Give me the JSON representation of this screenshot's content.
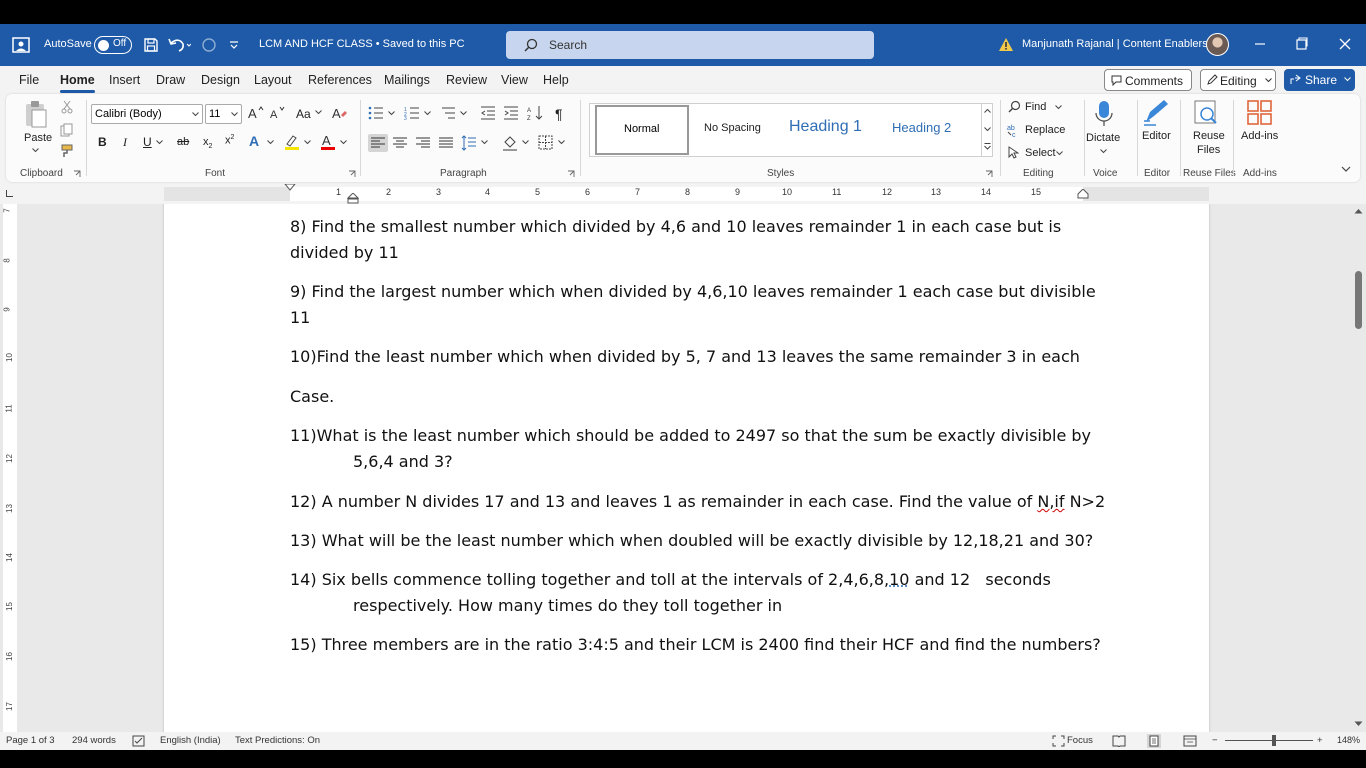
{
  "titlebar": {
    "autosave_label": "AutoSave",
    "autosave_state": "Off",
    "document_title": "LCM AND HCF CLASS • Saved to this PC",
    "search_placeholder": "Search",
    "user_name": "Manjunath Rajanal | Content Enablers"
  },
  "menu": {
    "tabs": [
      "File",
      "Home",
      "Insert",
      "Draw",
      "Design",
      "Layout",
      "References",
      "Mailings",
      "Review",
      "View",
      "Help"
    ],
    "active_tab": "Home",
    "comments_label": "Comments",
    "editing_label": "Editing",
    "share_label": "Share"
  },
  "ribbon": {
    "clipboard": {
      "paste_label": "Paste",
      "group_label": "Clipboard"
    },
    "font": {
      "font_name": "Calibri (Body)",
      "font_size": "11",
      "group_label": "Font",
      "change_case_label": "Aa"
    },
    "paragraph": {
      "group_label": "Paragraph"
    },
    "styles": {
      "items": [
        "Normal",
        "No Spacing",
        "Heading 1",
        "Heading 2"
      ],
      "group_label": "Styles"
    },
    "editing": {
      "find_label": "Find",
      "replace_label": "Replace",
      "select_label": "Select",
      "group_label": "Editing"
    },
    "voice": {
      "dictate_label": "Dictate",
      "group_label": "Voice"
    },
    "editor": {
      "editor_label": "Editor",
      "group_label": "Editor"
    },
    "reuse": {
      "label_line1": "Reuse",
      "label_line2": "Files",
      "group_label": "Reuse Files"
    },
    "addins": {
      "label": "Add-ins",
      "group_label": "Add-ins"
    }
  },
  "ruler": {
    "numbers": [
      "1",
      "2",
      "3",
      "4",
      "5",
      "6",
      "7",
      "8",
      "9",
      "10",
      "11",
      "12",
      "13",
      "14",
      "15"
    ],
    "vertical_numbers": [
      "7",
      "8",
      "9",
      "10",
      "11",
      "12",
      "13",
      "14",
      "15",
      "16",
      "17"
    ]
  },
  "document": {
    "q8_line1": "8) Find the smallest number which divided by 4,6 and 10 leaves remainder 1 in each case but is",
    "q8_line2": "divided by 11",
    "q9_line1": "9) Find the largest number which when divided by 4,6,10 leaves remainder 1 each case but divisible",
    "q9_line2": "11",
    "q10_line1": "10)Find the least number which when divided by 5, 7 and 13 leaves the same remainder 3 in each",
    "q10_line2": "Case.",
    "q11_line1": "11)What is the least number which should be added to 2497 so that the sum be exactly divisible by",
    "q11_line2": "5,6,4 and 3?",
    "q12_line1": "12) A number N divides 17 and 13 and leaves 1 as remainder in each case. Find the value of ",
    "q12_squiggle": "N,if",
    "q12_end": " N>2",
    "q13_line1": "13) What will be the least number which when doubled will be exactly divisible by 12,18,21 and 30?",
    "q14_line1a": "14) Six bells commence tolling together and toll at the intervals of 2,4,6,8,",
    "q14_dotted": "10",
    "q14_line1b": " and 12   seconds",
    "q14_line2": "respectively. How many times do they toll together in",
    "q15_line1": "15) Three members are in the ratio 3:4:5 and their LCM is 2400 find their HCF and find the numbers?"
  },
  "statusbar": {
    "page_info": "Page 1 of 3",
    "word_count": "294 words",
    "language": "English (India)",
    "text_predictions": "Text Predictions: On",
    "focus_label": "Focus",
    "zoom_level": "148%",
    "zoom_minus": "−",
    "zoom_plus": "+"
  },
  "colors": {
    "titlebar": "#1e5aa8",
    "accent": "#1e5aa8",
    "heading": "#2f6eb5"
  }
}
